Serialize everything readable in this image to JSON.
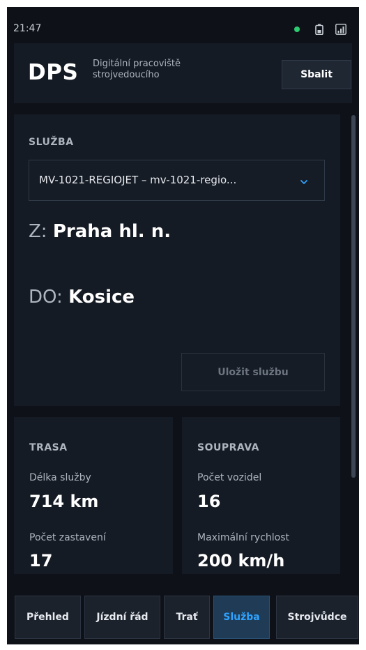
{
  "status_bar": {
    "time": "21:47",
    "indicator_color": "#2ecc71",
    "icons": [
      "battery-icon",
      "signal-icon"
    ]
  },
  "header": {
    "logo": "DPS",
    "subtitle": "Digitální pracoviště strojvedoucího",
    "collapse_label": "Sbalit"
  },
  "service": {
    "heading": "SLUŽBA",
    "selected": "MV-1021-REGIOJET – mv-1021-regio...",
    "from_prefix": "Z:",
    "from_value": "Praha hl. n.",
    "to_prefix": "DO:",
    "to_value": "Kosice",
    "save_label": "Uložit službu"
  },
  "route": {
    "heading": "TRASA",
    "length_label": "Délka služby",
    "length_value": "714 km",
    "stops_label": "Počet zastavení",
    "stops_value": "17"
  },
  "train": {
    "heading": "SOUPRAVA",
    "vehicles_label": "Počet vozidel",
    "vehicles_value": "16",
    "max_speed_label": "Maximální rychlost",
    "max_speed_value": "200 km/h"
  },
  "nav": {
    "tabs": [
      "Přehled",
      "Jízdní řád",
      "Trať",
      "Služba",
      "Strojvůdce"
    ],
    "active": "Služba"
  },
  "colors": {
    "background": "#0e1218",
    "card": "#151b24",
    "accent": "#2ea3ff"
  }
}
